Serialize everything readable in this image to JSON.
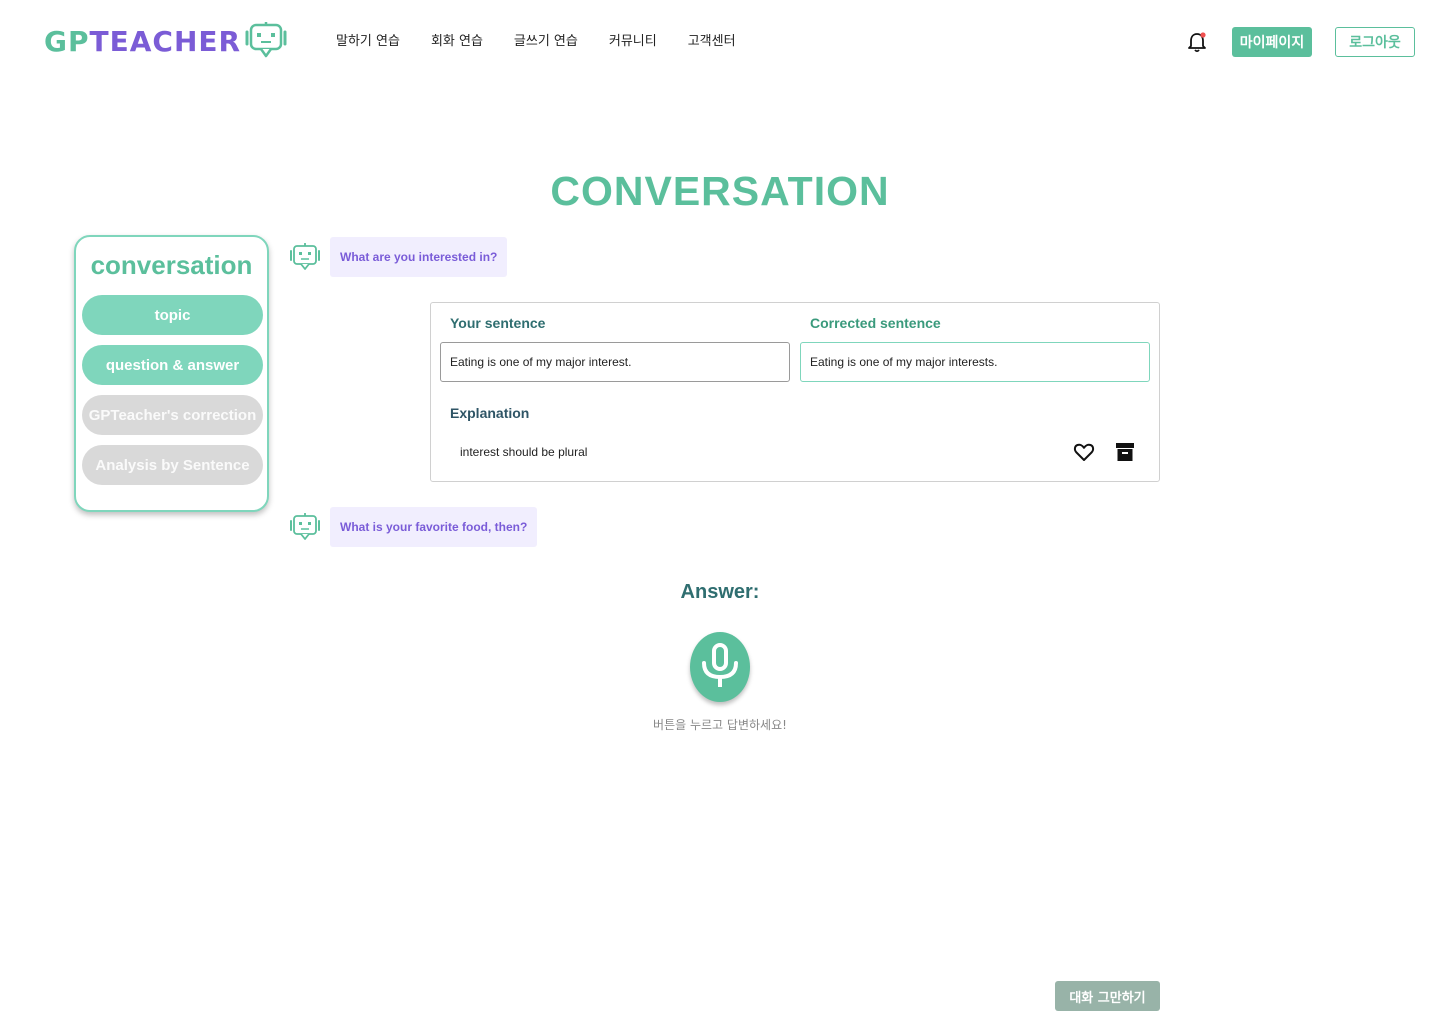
{
  "header": {
    "logo_gp": "GP",
    "logo_teacher": "TEACHER",
    "nav": [
      "말하기 연습",
      "회화 연습",
      "글쓰기 연습",
      "커뮤니티",
      "고객센터"
    ],
    "mypage_label": "마이페이지",
    "logout_label": "로그아웃"
  },
  "page_title": "CONVERSATION",
  "sidebar": {
    "title": "conversation",
    "items": [
      {
        "label": "topic",
        "state": "active"
      },
      {
        "label": "question & answer",
        "state": "active"
      },
      {
        "label": "GPTeacher's correction",
        "state": "inactive"
      },
      {
        "label": "Analysis by Sentence",
        "state": "inactive"
      }
    ]
  },
  "chat": {
    "question_1": "What are you interested in?",
    "correction": {
      "your_label": "Your sentence",
      "corrected_label": "Corrected sentence",
      "your_sentence": "Eating is one of my major interest.",
      "corrected_sentence": "Eating is one of my major interests.",
      "explanation_label": "Explanation",
      "explanation_text": "interest should be plural"
    },
    "question_2": "What is your favorite food, then?"
  },
  "answer": {
    "label": "Answer:",
    "hint": "버튼을 누르고 답변하세요!"
  },
  "stop_button_label": "대화 그만하기",
  "colors": {
    "brand_green": "#5bbf9c",
    "light_green": "#7fd6bc",
    "brand_purple": "#7b5cd6",
    "bubble_bg": "#f1eefe",
    "inactive_gray": "#d9d9d9"
  }
}
